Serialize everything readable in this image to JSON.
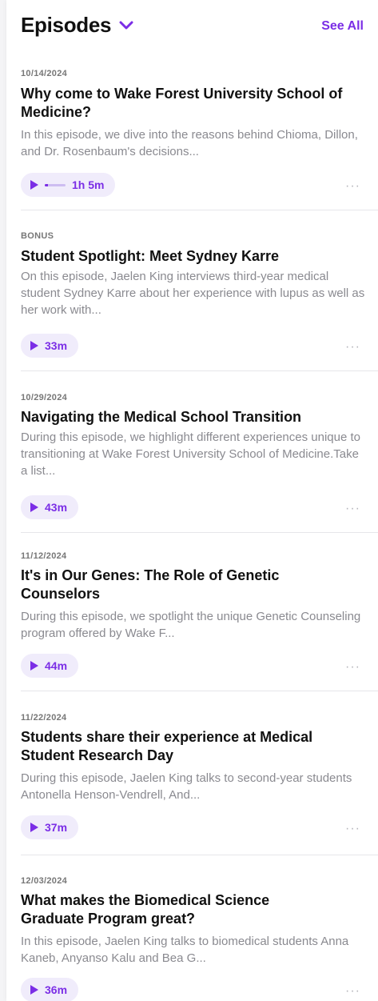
{
  "header": {
    "title": "Episodes",
    "see_all": "See All"
  },
  "colors": {
    "accent": "#7b2ee6",
    "pill_bg": "#f0ecfb"
  },
  "icons": {
    "chevron": "chevron-down-icon",
    "play": "play-icon",
    "more": "more-icon"
  },
  "episodes": [
    {
      "date": "10/14/2024",
      "title": "Why come to Wake Forest University School of Medicine?",
      "description": "In this episode, we dive into the reasons behind Chioma, Dillon, and Dr. Rosenbaum's decisions...",
      "duration": "1h 5m",
      "progress": 0.15,
      "more": "···"
    },
    {
      "date": "BONUS",
      "title": "Student Spotlight: Meet Sydney Karre",
      "description": "On this episode, Jaelen King interviews third-year medical student Sydney Karre about her experience with lupus as well as her work with...",
      "duration": "33m",
      "more": "···"
    },
    {
      "date": "10/29/2024",
      "title": "Navigating the Medical School Transition",
      "description": "During this episode, we highlight different experiences unique to transitioning at Wake Forest University School of Medicine.Take a list...",
      "duration": "43m",
      "more": "···"
    },
    {
      "date": "11/12/2024",
      "title": "It's in Our Genes: The Role of Genetic Counselors",
      "description": "During this episode, we spotlight the unique Genetic Counseling program offered by Wake F...",
      "duration": "44m",
      "more": "···"
    },
    {
      "date": "11/22/2024",
      "title": "Students share their experience at Medical Student Research Day",
      "description": "During this episode, Jaelen King talks to second-year students Antonella Henson-Vendrell, And...",
      "duration": "37m",
      "more": "···"
    },
    {
      "date": "12/03/2024",
      "title": "What makes the Biomedical Science Graduate Program great?",
      "description": "In this episode, Jaelen King talks to biomedical students Anna Kaneb, Anyanso Kalu and Bea G...",
      "duration": "36m",
      "more": "···"
    }
  ]
}
